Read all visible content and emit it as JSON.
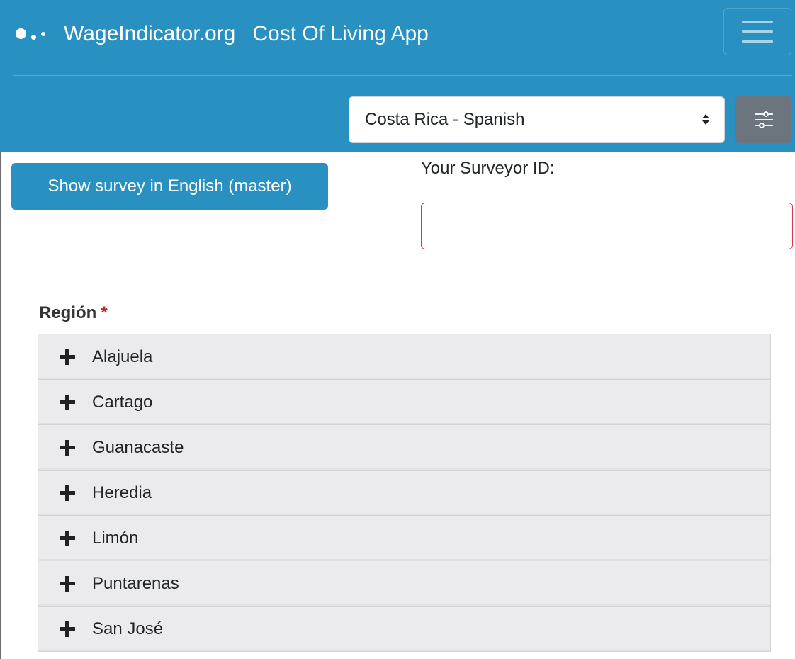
{
  "header": {
    "site_name": "WageIndicator.org",
    "app_name": "Cost Of Living App",
    "country_select": {
      "selected": "Costa Rica - Spanish"
    }
  },
  "main": {
    "english_button_label": "Show survey in English (master)",
    "surveyor_id": {
      "label": "Your Surveyor ID:",
      "value": ""
    },
    "region": {
      "label": "Región",
      "required_mark": "*",
      "items": [
        {
          "label": "Alajuela"
        },
        {
          "label": "Cartago"
        },
        {
          "label": "Guanacaste"
        },
        {
          "label": "Heredia"
        },
        {
          "label": "Limón"
        },
        {
          "label": "Puntarenas"
        },
        {
          "label": "San José"
        }
      ]
    }
  },
  "colors": {
    "primary": "#2891c2",
    "secondary": "#6c757d",
    "danger": "#dc3545",
    "required": "#c0272d",
    "accordion_bg": "#ebebed"
  },
  "icons": {
    "logo": "wageindicator-dots-logo",
    "menu": "hamburger-icon",
    "filter": "sliders-icon",
    "select_arrow": "chevron-updown-icon",
    "accordion": "plus-icon"
  }
}
